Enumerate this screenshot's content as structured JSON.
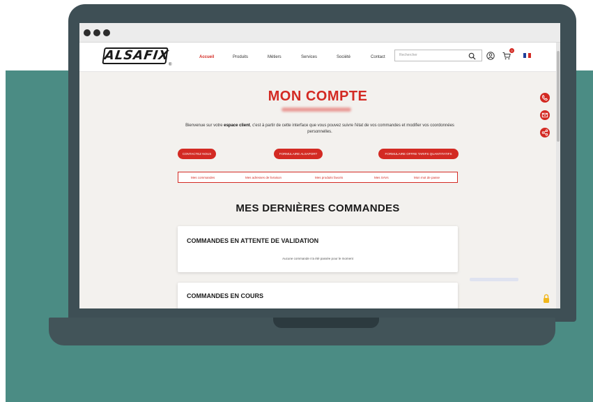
{
  "colors": {
    "brand_red": "#d32a23",
    "teal_background": "#4b8c84",
    "laptop_body": "#3e4f55"
  },
  "header": {
    "logo": "ALSAFIX",
    "logo_mark": "®",
    "nav": [
      "Accueil",
      "Produits",
      "Métiers",
      "Services",
      "Société",
      "Contact"
    ],
    "active_nav": "Accueil",
    "search_placeholder": "Rechercher",
    "icons": [
      "search-icon",
      "user-icon",
      "cart-icon",
      "france-flag-icon"
    ],
    "cart_count": "0"
  },
  "page": {
    "title": "MON COMPTE",
    "intro_before": "Bienvenue sur votre ",
    "intro_bold": "espace client",
    "intro_after": ", c'est à partir de cette interface que vous pouvez suivre l'état de vos commandes et modifier vos coordonnées personnelles.",
    "buttons": [
      "CONTACTEZ NOUS",
      "FORMULAIRE ALSAPORT",
      "FORMULAIRE OFFRE TARIFS QUANTITATIFS"
    ],
    "tabs": [
      "Mes commandes",
      "Mes adresses de livraison",
      "Mes produits favoris",
      "Mes SAVs",
      "Mon mot de passe"
    ],
    "section_title": "MES DERNIÈRES COMMANDES",
    "cards": [
      {
        "title": "COMMANDES EN ATTENTE DE VALIDATION",
        "note": "Aucune commande n'a été passée pour le moment"
      },
      {
        "title": "COMMANDES EN COURS",
        "note": ""
      }
    ]
  },
  "side_icons": [
    "phone-icon",
    "mail-icon",
    "share-icon"
  ]
}
